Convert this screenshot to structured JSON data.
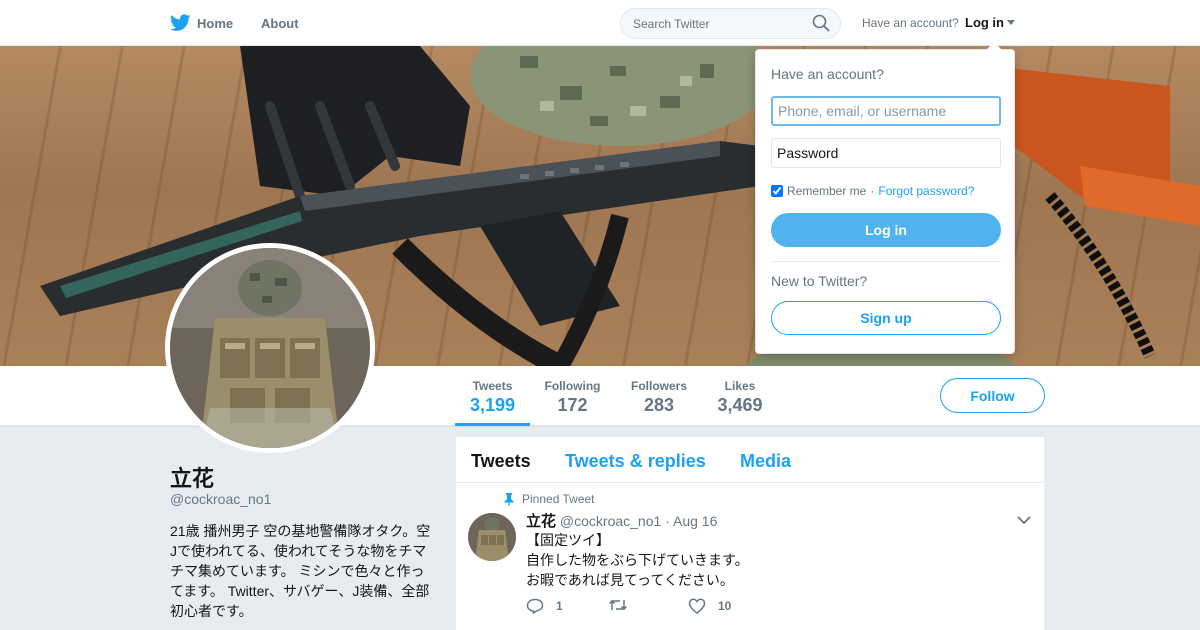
{
  "nav": {
    "home_label": "Home",
    "about_label": "About",
    "search_placeholder": "Search Twitter",
    "have_account": "Have an account?",
    "login_label": "Log in"
  },
  "stats": [
    {
      "label": "Tweets",
      "value": "3,199"
    },
    {
      "label": "Following",
      "value": "172"
    },
    {
      "label": "Followers",
      "value": "283"
    },
    {
      "label": "Likes",
      "value": "3,469"
    }
  ],
  "follow_label": "Follow",
  "profile": {
    "name": "立花",
    "handle": "@cockroac_no1",
    "bio": "21歳 播州男子 空の基地警備隊オタク。空Jで使われてる、使われてそうな物をチマチマ集めています。 ミシンで色々と作ってます。 Twitter、サバゲー、J装備、全部初心者です。"
  },
  "timeline": {
    "tabs": [
      "Tweets",
      "Tweets & replies",
      "Media"
    ]
  },
  "tweet": {
    "pinned_label": "Pinned Tweet",
    "name": "立花",
    "handle": "@cockroac_no1",
    "separator": "·",
    "date": "Aug 16",
    "lines": [
      "【固定ツイ】",
      "自作した物をぶら下げていきます。",
      "お暇であれば見てってください。"
    ],
    "reply_count": "1",
    "like_count": "10"
  },
  "login_dropdown": {
    "title": "Have an account?",
    "username_placeholder": "Phone, email, or username",
    "password_placeholder": "Password",
    "remember_label": "Remember me",
    "separator": "·",
    "forgot_label": "Forgot password?",
    "login_button": "Log in",
    "new_label": "New to Twitter?",
    "signup_button": "Sign up"
  },
  "colors": {
    "accent": "#1da1f2",
    "login_button": "#50b3f0",
    "background": "#e6ecf0"
  },
  "icons": [
    "twitter-bird-icon",
    "search-icon",
    "caret-down-icon",
    "pin-icon",
    "chevron-down-icon",
    "reply-icon",
    "retweet-icon",
    "heart-icon"
  ]
}
